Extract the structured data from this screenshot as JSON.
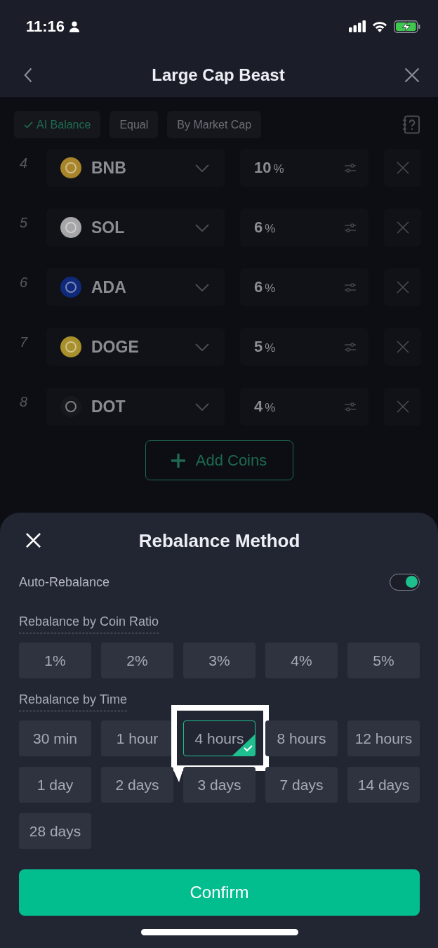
{
  "status_bar": {
    "time": "11:16"
  },
  "header": {
    "title": "Large Cap Beast"
  },
  "weighting_tabs": [
    {
      "label": "AI Balance",
      "selected": true
    },
    {
      "label": "Equal",
      "selected": false
    },
    {
      "label": "By Market Cap",
      "selected": false
    }
  ],
  "coins": [
    {
      "rank": "4",
      "symbol": "BNB",
      "color": "#a8852a",
      "percent": "10",
      "unit": "%"
    },
    {
      "rank": "5",
      "symbol": "SOL",
      "color": "#a6a6a8",
      "percent": "6",
      "unit": "%"
    },
    {
      "rank": "6",
      "symbol": "ADA",
      "color": "#10297a",
      "percent": "6",
      "unit": "%"
    },
    {
      "rank": "7",
      "symbol": "DOGE",
      "color": "#a8902c",
      "percent": "5",
      "unit": "%"
    },
    {
      "rank": "8",
      "symbol": "DOT",
      "color": "#17181d",
      "percent": "4",
      "unit": "%"
    }
  ],
  "add_button": {
    "label": "Add Coins"
  },
  "sheet": {
    "title": "Rebalance Method",
    "auto_rebalance": {
      "label": "Auto-Rebalance",
      "on": true
    },
    "coin_ratio": {
      "label": "Rebalance by Coin Ratio",
      "options": [
        {
          "label": "1%",
          "selected": false
        },
        {
          "label": "2%",
          "selected": false
        },
        {
          "label": "3%",
          "selected": false
        },
        {
          "label": "4%",
          "selected": false
        },
        {
          "label": "5%",
          "selected": false
        }
      ]
    },
    "time": {
      "label": "Rebalance by Time",
      "options": [
        {
          "label": "30 min",
          "selected": false,
          "highlighted": false
        },
        {
          "label": "1 hour",
          "selected": false,
          "highlighted": false
        },
        {
          "label": "4 hours",
          "selected": true,
          "highlighted": true
        },
        {
          "label": "8 hours",
          "selected": false,
          "highlighted": false
        },
        {
          "label": "12 hours",
          "selected": false,
          "highlighted": false
        },
        {
          "label": "1 day",
          "selected": false,
          "highlighted": false
        },
        {
          "label": "2 days",
          "selected": false,
          "highlighted": false
        },
        {
          "label": "3 days",
          "selected": false,
          "highlighted": false
        },
        {
          "label": "7 days",
          "selected": false,
          "highlighted": false
        },
        {
          "label": "14 days",
          "selected": false,
          "highlighted": false
        },
        {
          "label": "28 days",
          "selected": false,
          "highlighted": false
        }
      ]
    },
    "confirm": {
      "label": "Confirm"
    }
  }
}
